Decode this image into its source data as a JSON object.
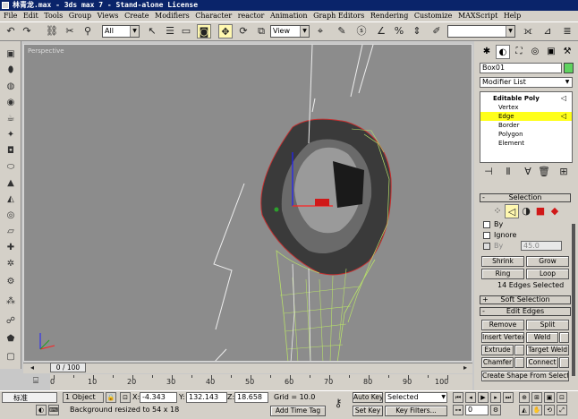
{
  "titlebar": {
    "title": "林青龙.max - 3ds max 7  - Stand-alone License"
  },
  "menu": [
    "File",
    "Edit",
    "Tools",
    "Group",
    "Views",
    "Create",
    "Modifiers",
    "Character",
    "reactor",
    "Animation",
    "Graph Editors",
    "Rendering",
    "Customize",
    "MAXScript",
    "Help"
  ],
  "toolbar": {
    "selection_filter": "All",
    "ref_coord": "View"
  },
  "viewport": {
    "label": "Perspective"
  },
  "command_panel": {
    "object_name": "Box01",
    "object_color": "#5fd35f",
    "modifier_list": "Modifier List",
    "stack": {
      "root": "Editable Poly",
      "items": [
        "Vertex",
        "Edge",
        "Border",
        "Polygon",
        "Element"
      ],
      "selected": "Edge"
    },
    "selection": {
      "title": "Selection",
      "by_vertex": "By",
      "ignore": "Ignore",
      "by_angle": "By",
      "angle_value": "45.0",
      "shrink": "Shrink",
      "grow": "Grow",
      "ring": "Ring",
      "loop": "Loop",
      "status": "14 Edges Selected"
    },
    "soft_selection": {
      "title": "Soft Selection"
    },
    "edit_edges": {
      "title": "Edit Edges",
      "remove": "Remove",
      "split": "Split",
      "insert_vertex": "Insert Vertex",
      "weld": "Weld",
      "extrude": "Extrude",
      "target_weld": "Target Weld",
      "chamfer": "Chamfer",
      "connect": "Connect",
      "create_shape": "Create Shape From Selection"
    }
  },
  "timeline": {
    "slider": "0 / 100",
    "ticks": [
      "0",
      "10",
      "20",
      "30",
      "40",
      "50",
      "60",
      "70",
      "80",
      "90",
      "100"
    ],
    "current_frame": 0,
    "total_frames": 100
  },
  "status": {
    "ime": "标准",
    "objects": "1 Object",
    "x_label": "X:",
    "x": "-4.343",
    "y_label": "Y:",
    "y": "132.143",
    "z_label": "Z:",
    "z": "18.658",
    "grid": "Grid = 10.0",
    "prompt": "Background resized to 54 x 18",
    "add_time_tag": "Add Time Tag",
    "auto_key": "Auto Key",
    "set_key": "Set Key",
    "selected_dropdown": "Selected",
    "key_filters": "Key Filters..."
  }
}
